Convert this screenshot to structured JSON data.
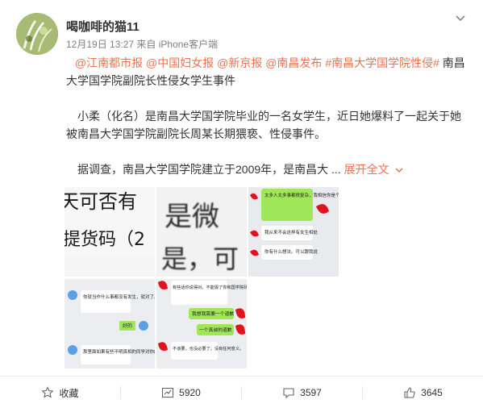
{
  "post": {
    "username": "喝咖啡的猫11",
    "timestamp": "12月19日 13:27",
    "source": "来自 iPhone客户端",
    "mentions": [
      "@江南都市报",
      "@中国妇女报",
      "@新京报",
      "@南昌发布"
    ],
    "hashtag": "#南昌大学国学院性侵#",
    "headline": "南昌大学国学院副院长性侵女学生事件",
    "para1": "小柔（化名）是南昌大学国学院毕业的一名女学生，近日她爆料了一起关于她被南昌大学国学院副院长周某长期猥亵、性侵事件。",
    "para2": "据调查，南昌大学国学院建立于2009年，是南昌大 ...",
    "expand": "展开全文"
  },
  "images": {
    "img1_line1": "天可否有",
    "img1_line2": "提货码（2",
    "img2_line1": "是微",
    "img2_line2": "是，可",
    "img3_msg1": "太多人太多事都很复杂，我相信你是个善良的人",
    "img3_msg2": "我从来不会这样有女生相处",
    "img3_msg3": "你有什么想法。可以跟我说",
    "img4_msg1": "你就当作什么事都没有发生，就对了。",
    "img4_msg2": "好的",
    "img4_msg3": "那里面如果有些不明真相的同学对你的贴子有",
    "img5_msg1": "有些话你说得对。不能毁了你和国学院研究调表师继续我们的前程。",
    "img5_msg2": "我想我需要一个道歉",
    "img5_msg3": "一个真诚的道歉",
    "img5_msg4": "不该要。也没必要了。没有任何意义。"
  },
  "actions": {
    "favorite": "收藏",
    "repost": "5920",
    "comment": "3597",
    "like": "3645"
  },
  "colors": {
    "link": "#eb7350",
    "text": "#333333",
    "meta": "#808080",
    "chat_green": "#9fe658",
    "chat_red": "#e0141e"
  }
}
